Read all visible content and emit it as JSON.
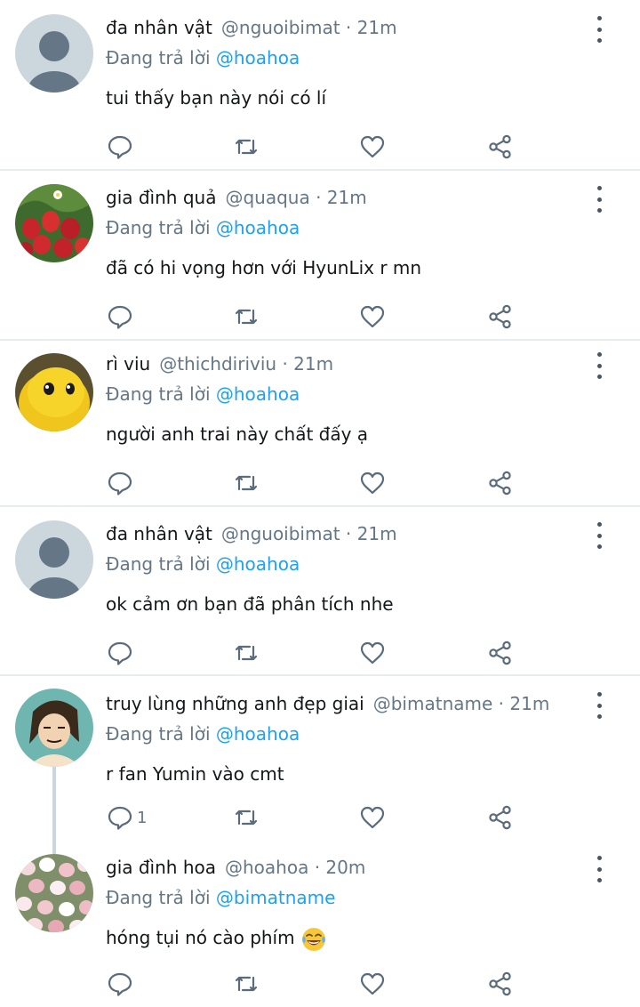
{
  "tweets": [
    {
      "name": "đa nhân vật",
      "handle": "@nguoibimat",
      "time": "21m",
      "replying_prefix": "Đang trả lời",
      "replying_to": "@hoahoa",
      "text": "tui thấy bạn này nói có lí",
      "reply_count": "",
      "avatar": "default-avatar"
    },
    {
      "name": "gia đình quả",
      "handle": "@quaqua",
      "time": "21m",
      "replying_prefix": "Đang trả lời",
      "replying_to": "@hoahoa",
      "text": "đã có hi vọng hơn với HyunLix r mn",
      "reply_count": "",
      "avatar": "strawberry-avatar"
    },
    {
      "name": "rì viu",
      "handle": "@thichdiriviu",
      "time": "21m",
      "replying_prefix": "Đang trả lời",
      "replying_to": "@hoahoa",
      "text": "người anh trai này chất đấy ạ",
      "reply_count": "",
      "avatar": "yellow-creature-avatar"
    },
    {
      "name": "đa nhân vật",
      "handle": "@nguoibimat",
      "time": "21m",
      "replying_prefix": "Đang trả lời",
      "replying_to": "@hoahoa",
      "text": "ok cảm ơn bạn đã phân tích nhe",
      "reply_count": "",
      "avatar": "default-avatar"
    },
    {
      "name": "truy lùng những anh đẹp giai",
      "handle": "@bimatname",
      "time": "21m",
      "replying_prefix": "Đang trả lời",
      "replying_to": "@hoahoa",
      "text": "r fan Yumin vào cmt",
      "reply_count": "1",
      "avatar": "drawing-avatar"
    },
    {
      "name": "gia đình hoa",
      "handle": "@hoahoa",
      "time": "20m",
      "replying_prefix": "Đang trả lời",
      "replying_to": "@bimatname",
      "text": "hóng tụi nó cào phím",
      "reply_count": "",
      "avatar": "tulips-avatar",
      "emoji": "laughing-tears-emoji"
    }
  ],
  "separator": "·",
  "icons": {
    "reply": "reply-icon",
    "retweet": "retweet-icon",
    "like": "like-icon",
    "share": "share-icon",
    "more": "more-vertical-icon"
  },
  "colors": {
    "link": "#1da1f2",
    "secondary": "#657786",
    "divider": "#e6ecf0",
    "icon": "#5b6b7a"
  }
}
